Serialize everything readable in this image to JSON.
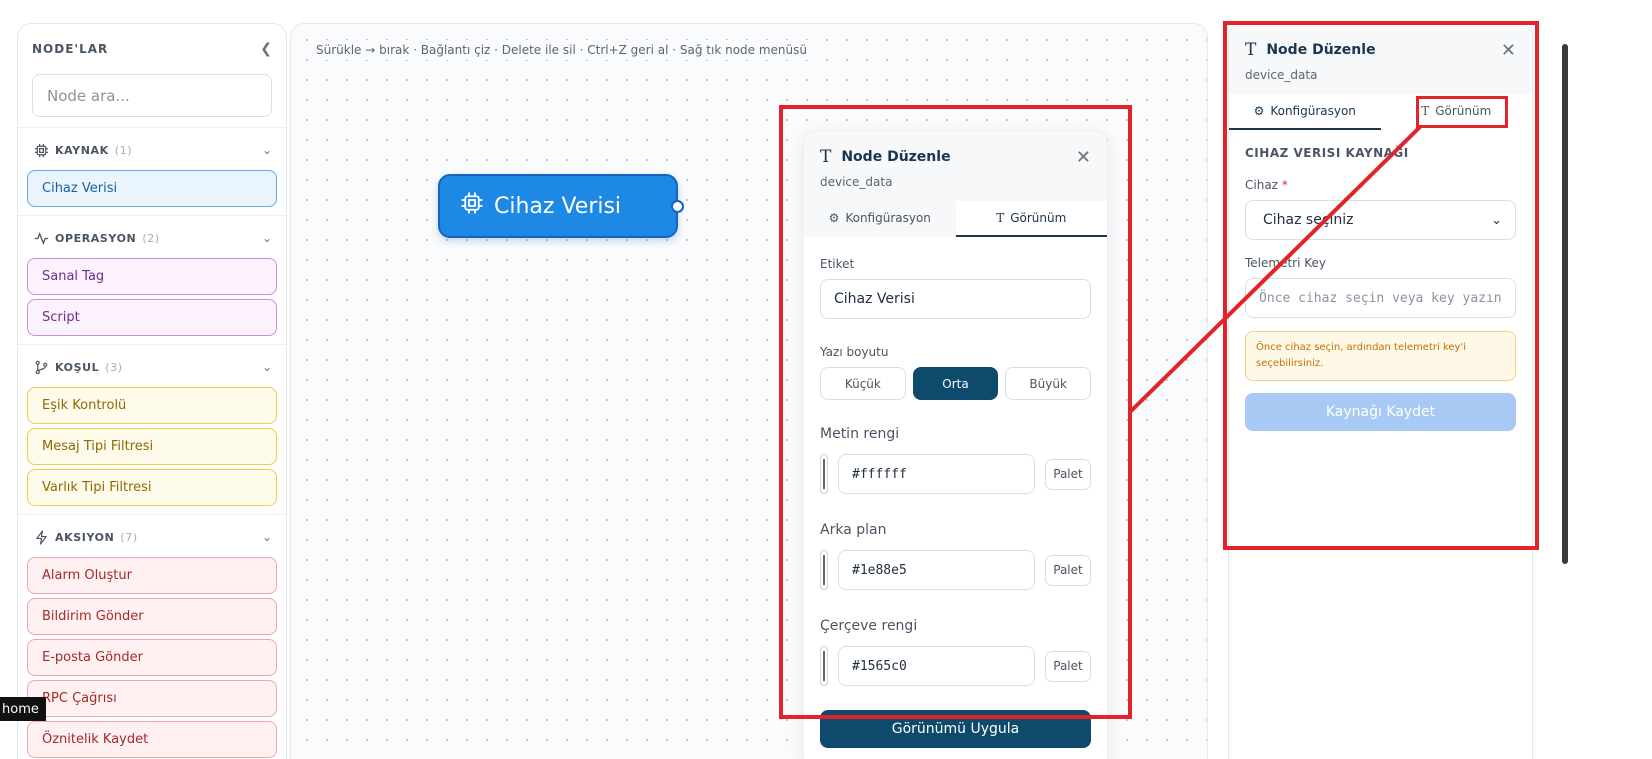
{
  "sidebar": {
    "title": "NODE'LAR",
    "search_placeholder": "Node ara...",
    "categories": [
      {
        "name": "KAYNAK",
        "count": "(1)",
        "items": [
          "Cihaz Verisi"
        ]
      },
      {
        "name": "OPERASYON",
        "count": "(2)",
        "items": [
          "Sanal Tag",
          "Script"
        ]
      },
      {
        "name": "KOŞUL",
        "count": "(3)",
        "items": [
          "Eşik Kontrolü",
          "Mesaj Tipi Filtresi",
          "Varlık Tipi Filtresi"
        ]
      },
      {
        "name": "AKSIYON",
        "count": "(7)",
        "items": [
          "Alarm Oluştur",
          "Bildirim Gönder",
          "E-posta Gönder",
          "RPC Çağrısı",
          "Öznitelik Kaydet"
        ]
      }
    ]
  },
  "canvas": {
    "hint": "Sürükle → bırak · Bağlantı çiz · Delete ile sil · Ctrl+Z geri al · Sağ tık node menüsü",
    "node": {
      "label": "Cihaz Verisi",
      "bg": "#1e88e5",
      "border": "#1565c0"
    }
  },
  "edit_panel": {
    "title": "Node Düzenle",
    "subtitle": "device_data",
    "tabs": [
      "Konfigürasyon",
      "Görünüm"
    ],
    "label_title": "Etiket",
    "label_value": "Cihaz Verisi",
    "font_size_title": "Yazı boyutu",
    "font_sizes": [
      "Küçük",
      "Orta",
      "Büyük"
    ],
    "selected_font_size": "Orta",
    "text_color_title": "Metin rengi",
    "text_color": "#ffffff",
    "bg_color_title": "Arka plan",
    "bg_color": "#1e88e5",
    "border_color_title": "Çerçeve rengi",
    "border_color": "#1565c0",
    "palette_label": "Palet",
    "apply_label": "Görünümü Uygula"
  },
  "right_panel": {
    "title": "Node Düzenle",
    "subtitle": "device_data",
    "tabs": [
      "Konfigürasyon",
      "Görünüm"
    ],
    "section_title": "CIHAZ VERISI KAYNAĞI",
    "device_label": "Cihaz",
    "device_required": "*",
    "device_value": "Cihaz seçiniz",
    "telemetry_label": "Telemetri Key",
    "telemetry_placeholder": "Önce cihaz seçin veya key yazın",
    "warning": "Önce cihaz seçin, ardından telemetri key'i seçebilirsiniz.",
    "save_label": "Kaynağı Kaydet"
  },
  "taskbar": {
    "label": "home"
  },
  "colors": {
    "primary": "#0d4a6b",
    "annotation": "#e0242a"
  }
}
